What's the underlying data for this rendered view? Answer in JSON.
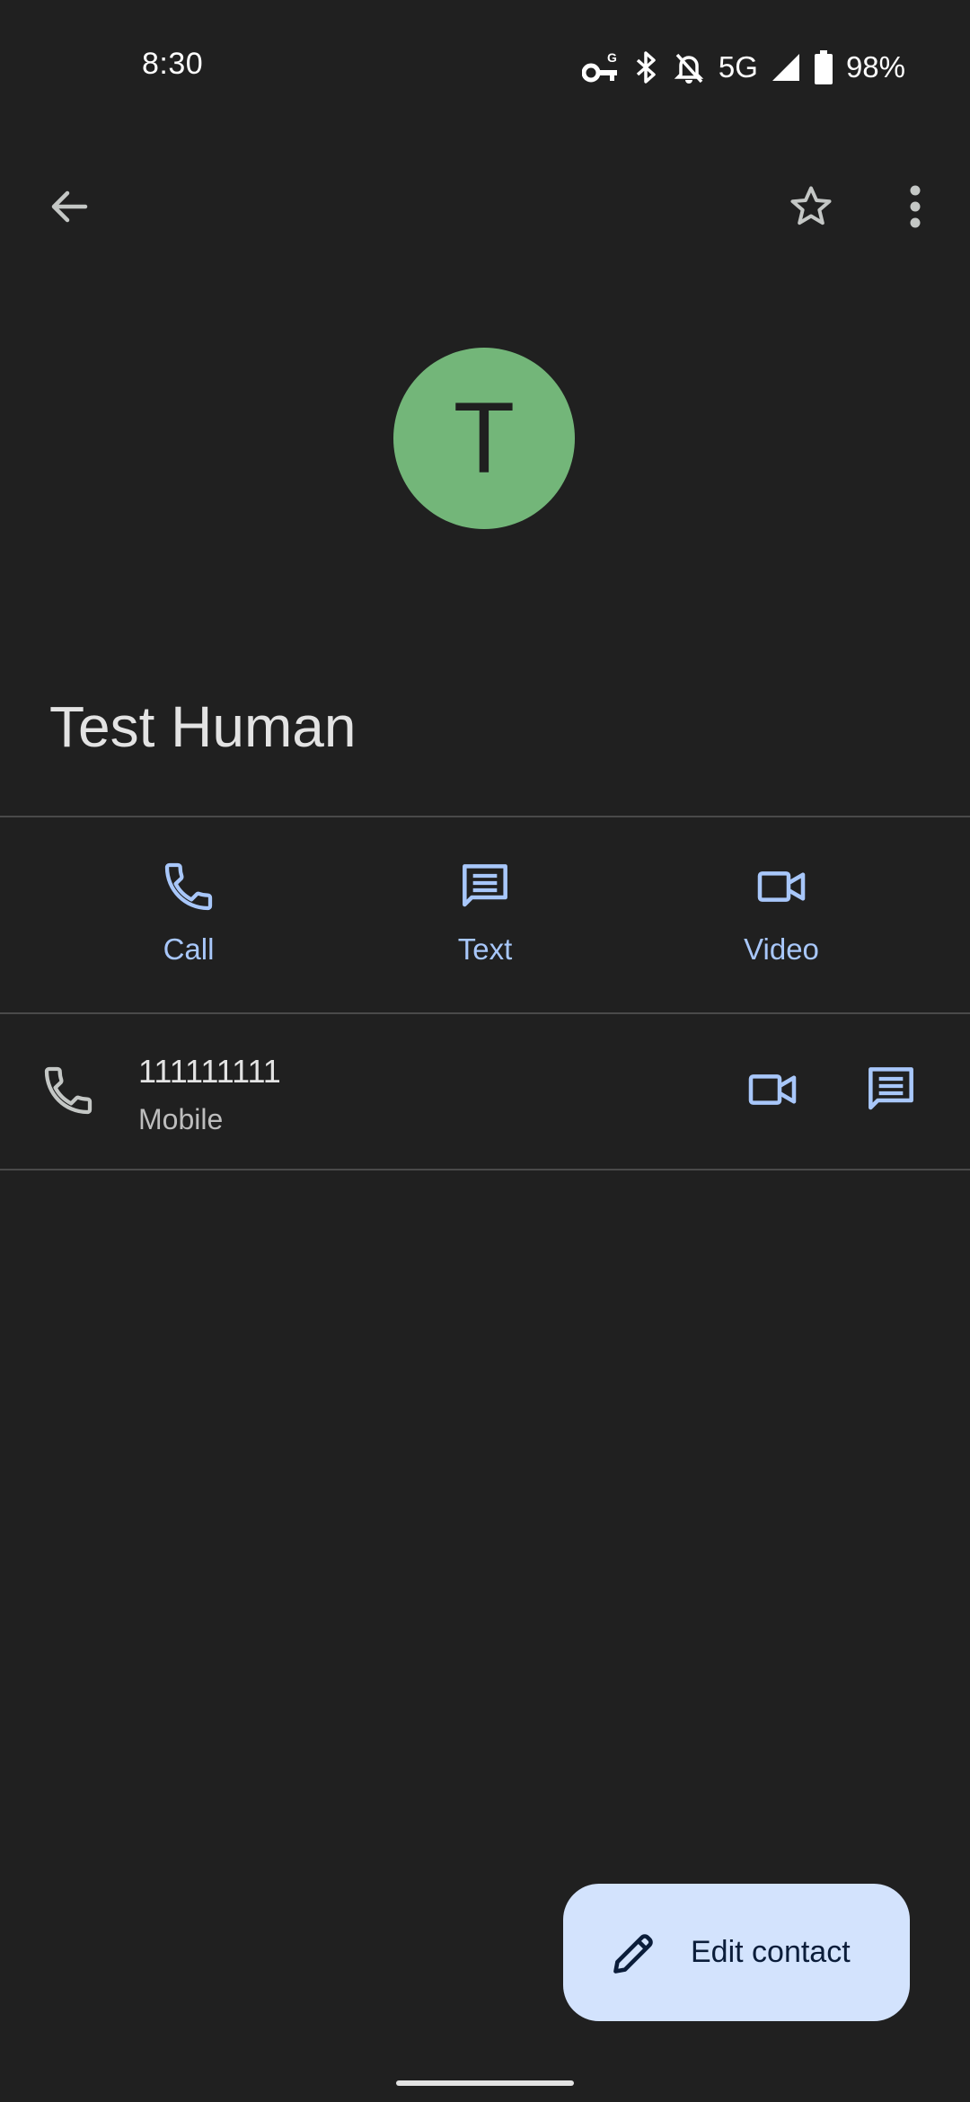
{
  "status_bar": {
    "time": "8:30",
    "network": "5G",
    "battery": "98%",
    "icons": [
      "vpn-key-icon",
      "bluetooth-icon",
      "notifications-off-icon",
      "signal-icon",
      "battery-icon"
    ]
  },
  "app_bar": {
    "icons": [
      "back-arrow-icon",
      "star-outline-icon",
      "more-vert-icon"
    ]
  },
  "contact": {
    "initial": "T",
    "avatar_color": "#73b679",
    "name": "Test Human"
  },
  "actions": [
    {
      "label": "Call",
      "icon": "phone-icon"
    },
    {
      "label": "Text",
      "icon": "message-icon"
    },
    {
      "label": "Video",
      "icon": "videocam-icon"
    }
  ],
  "phone_entry": {
    "number": "111111111",
    "type": "Mobile"
  },
  "fab": {
    "label": "Edit contact",
    "icon": "edit-pencil-icon"
  },
  "colors": {
    "background": "#202020",
    "accent": "#a8c7fa",
    "fab_background": "#d3e3fd"
  }
}
